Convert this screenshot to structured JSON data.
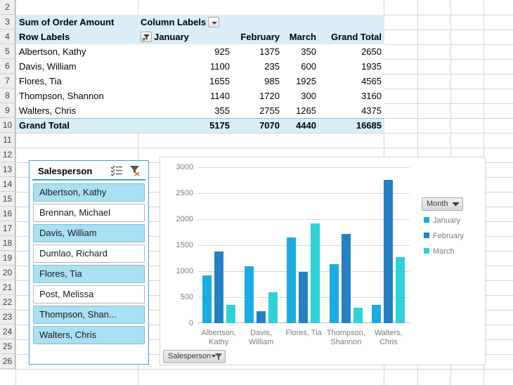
{
  "spreadsheet": {
    "row_headers": [
      2,
      3,
      4,
      5,
      6,
      7,
      8,
      9,
      10,
      11,
      12,
      13,
      14,
      15,
      16,
      17,
      18,
      19,
      20,
      21,
      22,
      23,
      24,
      25,
      26
    ]
  },
  "pivot": {
    "value_field_label": "Sum of Order Amount",
    "column_labels_label": "Column Labels",
    "row_labels_label": "Row Labels",
    "columns": [
      "January",
      "February",
      "March",
      "Grand Total"
    ],
    "rows": [
      {
        "name": "Albertson, Kathy",
        "values": [
          "925",
          "1375",
          "350",
          "2650"
        ]
      },
      {
        "name": "Davis, William",
        "values": [
          "1100",
          "235",
          "600",
          "1935"
        ]
      },
      {
        "name": "Flores, Tia",
        "values": [
          "1655",
          "985",
          "1925",
          "4565"
        ]
      },
      {
        "name": "Thompson, Shannon",
        "values": [
          "1140",
          "1720",
          "300",
          "3160"
        ]
      },
      {
        "name": "Walters, Chris",
        "values": [
          "355",
          "2755",
          "1265",
          "4375"
        ]
      }
    ],
    "grand_total": {
      "label": "Grand Total",
      "values": [
        "5175",
        "7070",
        "4440",
        "16685"
      ]
    }
  },
  "slicer": {
    "title": "Salesperson",
    "multi_select_icon": "multi-select-icon",
    "clear_filter_icon": "clear-filter-icon",
    "items": [
      {
        "label": "Albertson, Kathy",
        "selected": true
      },
      {
        "label": "Brennan, Michael",
        "selected": false
      },
      {
        "label": "Davis, William",
        "selected": true
      },
      {
        "label": "Dumlao, Richard",
        "selected": false
      },
      {
        "label": "Flores, Tia",
        "selected": true
      },
      {
        "label": "Post, Melissa",
        "selected": false
      },
      {
        "label": "Thompson, Shan...",
        "selected": true
      },
      {
        "label": "Walters, Chris",
        "selected": true
      }
    ],
    "border_color": "#3ba2d6",
    "selected_color": "#a8e0f4"
  },
  "chart_filters": {
    "month_label": "Month",
    "salesperson_label": "Salesperson"
  },
  "chart_data": {
    "type": "bar",
    "title": "",
    "xlabel": "",
    "ylabel": "",
    "ylim": [
      0,
      3000
    ],
    "yticks": [
      0,
      500,
      1000,
      1500,
      2000,
      2500,
      3000
    ],
    "grid": true,
    "legend_position": "right",
    "legend_title": "Month",
    "categories": [
      "Albertson, Kathy",
      "Davis, William",
      "Flores, Tia",
      "Thompson, Shannon",
      "Walters, Chris"
    ],
    "series": [
      {
        "name": "January",
        "color": "#1cabe3",
        "values": [
          925,
          1100,
          1655,
          1140,
          355
        ]
      },
      {
        "name": "February",
        "color": "#2581c4",
        "values": [
          1375,
          235,
          985,
          1720,
          2755
        ]
      },
      {
        "name": "March",
        "color": "#2fd1da",
        "values": [
          350,
          600,
          1925,
          300,
          1265
        ]
      }
    ]
  }
}
